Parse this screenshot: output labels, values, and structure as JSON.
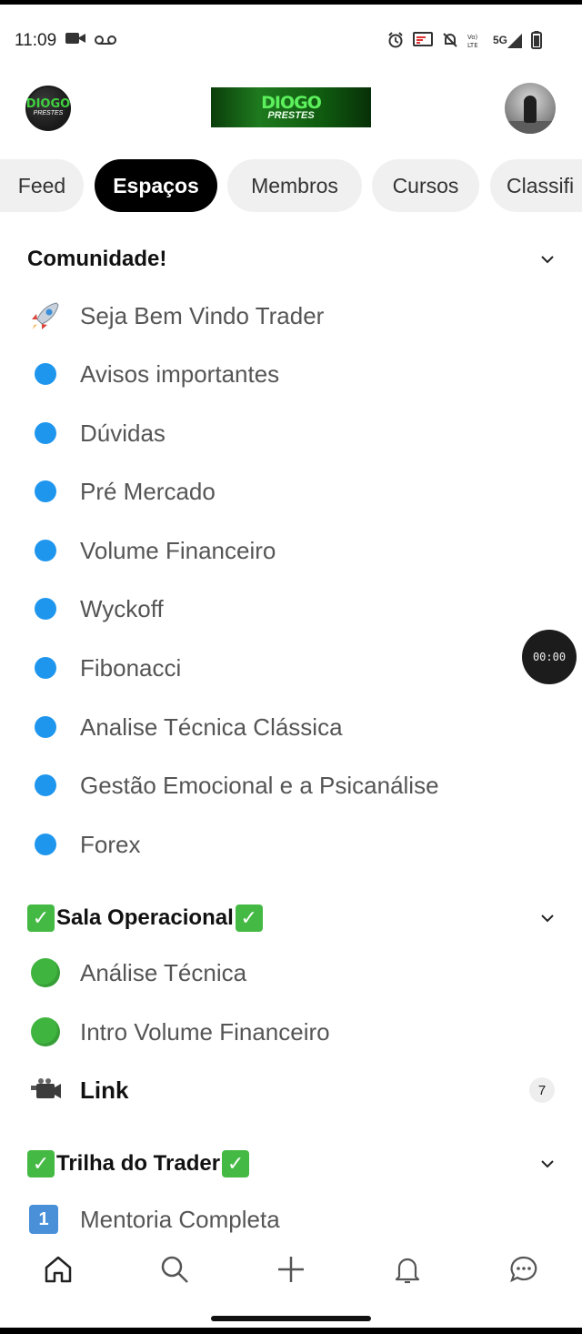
{
  "status_bar": {
    "time": "11:09",
    "left_icons": [
      "video-camera-icon",
      "voicemail-icon"
    ],
    "right_icons": [
      "alarm-icon",
      "cast-icon",
      "mute-icon",
      "volte-icon",
      "signal-5g-icon",
      "battery-icon"
    ],
    "network_label": "5G"
  },
  "header": {
    "logo_line1": "DIOGO",
    "logo_line2": "PRESTES",
    "banner_line1": "DIOGO",
    "banner_line2": "PRESTES"
  },
  "tabs": [
    {
      "label": "Feed",
      "active": false
    },
    {
      "label": "Espaços",
      "active": true
    },
    {
      "label": "Membros",
      "active": false
    },
    {
      "label": "Cursos",
      "active": false
    },
    {
      "label": "Classifi",
      "active": false
    }
  ],
  "sections": [
    {
      "title": "Comunidade!",
      "items": [
        {
          "label": "Seja Bem Vindo Trader",
          "icon": "rocket-icon"
        },
        {
          "label": "Avisos importantes",
          "icon": "blue-dot-icon"
        },
        {
          "label": "Dúvidas",
          "icon": "blue-dot-icon"
        },
        {
          "label": "Pré Mercado",
          "icon": "blue-dot-icon"
        },
        {
          "label": "Volume Financeiro",
          "icon": "blue-dot-icon"
        },
        {
          "label": "Wyckoff",
          "icon": "blue-dot-icon"
        },
        {
          "label": "Fibonacci",
          "icon": "blue-dot-icon"
        },
        {
          "label": "Analise Técnica Clássica",
          "icon": "blue-dot-icon"
        },
        {
          "label": "Gestão Emocional e a Psicanálise",
          "icon": "blue-dot-icon"
        },
        {
          "label": "Forex",
          "icon": "blue-dot-icon"
        }
      ]
    },
    {
      "title": "Sala Operacional",
      "items": [
        {
          "label": "Análise Técnica",
          "icon": "green-circle-icon"
        },
        {
          "label": "Intro Volume Financeiro",
          "icon": "green-circle-icon"
        },
        {
          "label": "Link",
          "icon": "video-camera-icon",
          "badge": "7"
        }
      ]
    },
    {
      "title": "Trilha do Trader",
      "items": [
        {
          "label": "Mentoria Completa",
          "icon": "keycap-one-icon",
          "keycap": "1"
        }
      ]
    }
  ],
  "timer": "00:00",
  "bottom_nav": [
    "home-icon",
    "search-icon",
    "plus-icon",
    "bell-icon",
    "chat-icon"
  ],
  "colors": {
    "accent_dot": "#1f96ee",
    "green_dot": "#3fb53f",
    "tab_active_bg": "#000000",
    "tab_bg": "#f0f0f0"
  }
}
